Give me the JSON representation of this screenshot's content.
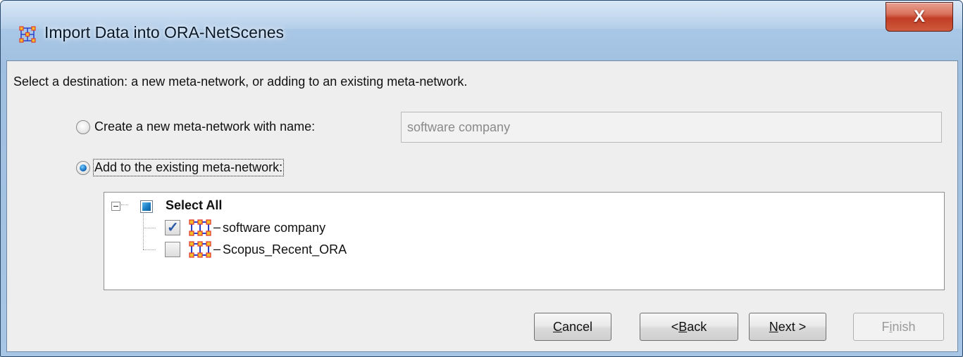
{
  "window": {
    "title": "Import Data into ORA-NetScenes",
    "close_label": "X"
  },
  "instruction": "Select a destination: a new meta-network, or adding to an existing meta-network.",
  "options": {
    "create_new": {
      "label": "Create a new meta-network with name:",
      "selected": false,
      "name_value": "software company"
    },
    "add_existing": {
      "label": "Add to the existing meta-network:",
      "selected": true
    }
  },
  "tree": {
    "root": {
      "label": "Select All",
      "state": "partial",
      "expanded": true
    },
    "items": [
      {
        "label": "software company",
        "checked": true,
        "icon": "meta-network-icon",
        "suffix": "–"
      },
      {
        "label": "Scopus_Recent_ORA",
        "checked": false,
        "icon": "meta-network-icon",
        "suffix": "–"
      }
    ]
  },
  "buttons": {
    "cancel": {
      "label": "Cancel",
      "mnemonic": "C",
      "rest": "ancel",
      "enabled": true
    },
    "back": {
      "label": "< Back",
      "prefix": "< ",
      "mnemonic": "B",
      "rest": "ack",
      "enabled": true
    },
    "next": {
      "label": "Next >",
      "mnemonic": "N",
      "rest": "ext >",
      "enabled": true
    },
    "finish": {
      "label": "Finish",
      "prefix": "F",
      "mnemonic": "i",
      "rest": "nish",
      "enabled": false
    }
  },
  "colors": {
    "title_bar": "#a7c5e4",
    "close_button": "#c13d24",
    "dialog_bg": "#eeeeee",
    "check_mark": "#2a5aa8",
    "partial_fill": "#1a7ec4",
    "network_node_red": "#e23b2e",
    "network_node_yellow": "#f2c02a",
    "network_edge_blue": "#2a3fc8"
  }
}
